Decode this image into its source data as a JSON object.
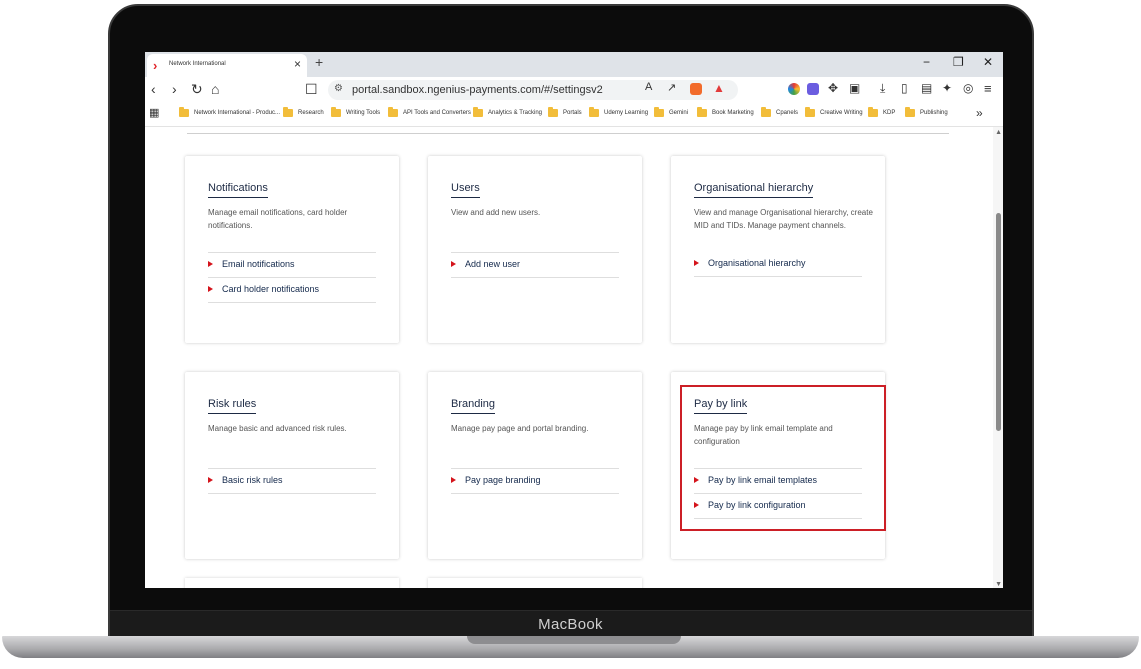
{
  "device": {
    "brand": "MacBook"
  },
  "browser": {
    "tab": {
      "title": "Network International"
    },
    "window_controls": {
      "minimize": "−",
      "restore": "❐",
      "close": "✕"
    },
    "address": {
      "url": "portal.sandbox.ngenius-payments.com/#/settingsv2"
    },
    "bookmarks": [
      "Network International - Produc...",
      "Research",
      "Writing Tools",
      "API Tools and Converters",
      "Analytics & Tracking",
      "Portals",
      "Udemy Learning",
      "Gemini",
      "Book Marketing",
      "Cpanels",
      "Creative Writing",
      "KDP",
      "Publishing"
    ],
    "bookmarks_overflow": "»"
  },
  "cards": [
    {
      "title": "Notifications",
      "description": "Manage email notifications, card holder notifications.",
      "links": [
        "Email notifications",
        "Card holder notifications"
      ]
    },
    {
      "title": "Users",
      "description": "View and add new users.",
      "links": [
        "Add new user"
      ]
    },
    {
      "title": "Organisational hierarchy",
      "description": "View and manage Organisational hierarchy, create MID and TIDs. Manage payment channels.",
      "links": [
        "Organisational hierarchy"
      ]
    },
    {
      "title": "Risk rules",
      "description": "Manage basic and advanced risk rules.",
      "links": [
        "Basic risk rules"
      ]
    },
    {
      "title": "Branding",
      "description": "Manage pay page and portal branding.",
      "links": [
        "Pay page branding"
      ]
    },
    {
      "title": "Pay by link",
      "description": "Manage pay by link email template and configuration",
      "links": [
        "Pay by link email templates",
        "Pay by link configuration"
      ]
    }
  ],
  "colors": {
    "accent": "#d4141c",
    "link": "#13284b",
    "highlight": "#cc1f26"
  }
}
